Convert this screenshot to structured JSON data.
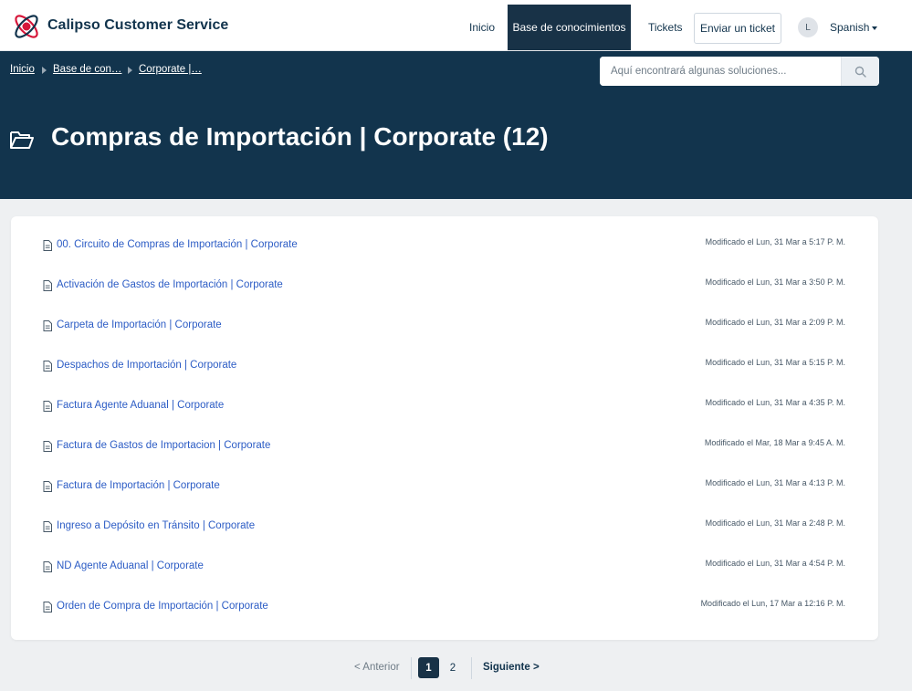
{
  "header": {
    "brand": "Calipso Customer Service",
    "nav": {
      "home": "Inicio",
      "knowledge_base": "Base de conocimientos",
      "tickets": "Tickets",
      "submit_ticket": "Enviar un ticket"
    },
    "avatar_initial": "L",
    "language": "Spanish"
  },
  "breadcrumb": [
    "Inicio",
    "Base de con…",
    "Corporate |…"
  ],
  "search": {
    "placeholder": "Aquí encontrará algunas soluciones..."
  },
  "page_title": "Compras de Importación | Corporate (12)",
  "articles": [
    {
      "title": "00. Circuito de Compras de Importación | Corporate",
      "modified": "Modificado el Lun, 31 Mar a 5:17 P. M."
    },
    {
      "title": "Activación de Gastos de Importación | Corporate",
      "modified": "Modificado el Lun, 31 Mar a 3:50 P. M."
    },
    {
      "title": "Carpeta de Importación | Corporate",
      "modified": "Modificado el Lun, 31 Mar a 2:09 P. M."
    },
    {
      "title": "Despachos de Importación | Corporate",
      "modified": "Modificado el Lun, 31 Mar a 5:15 P. M."
    },
    {
      "title": "Factura Agente Aduanal | Corporate",
      "modified": "Modificado el Lun, 31 Mar a 4:35 P. M."
    },
    {
      "title": "Factura de Gastos de Importacion | Corporate",
      "modified": "Modificado el Mar, 18 Mar a 9:45 A. M."
    },
    {
      "title": "Factura de Importación | Corporate",
      "modified": "Modificado el Lun, 31 Mar a 4:13 P. M."
    },
    {
      "title": "Ingreso a Depósito en Tránsito | Corporate",
      "modified": "Modificado el Lun, 31 Mar a 2:48 P. M."
    },
    {
      "title": "ND Agente Aduanal | Corporate",
      "modified": "Modificado el Lun, 31 Mar a 4:54 P. M."
    },
    {
      "title": "Orden de Compra de Importación | Corporate",
      "modified": "Modificado el Lun, 17 Mar a 12:16 P. M."
    }
  ],
  "pagination": {
    "prev": "< Anterior",
    "pages": [
      "1",
      "2"
    ],
    "next": "Siguiente >"
  },
  "colors": {
    "header_dark": "#12344d",
    "link": "#2c5cc5",
    "brand_red": "#d6173a"
  }
}
